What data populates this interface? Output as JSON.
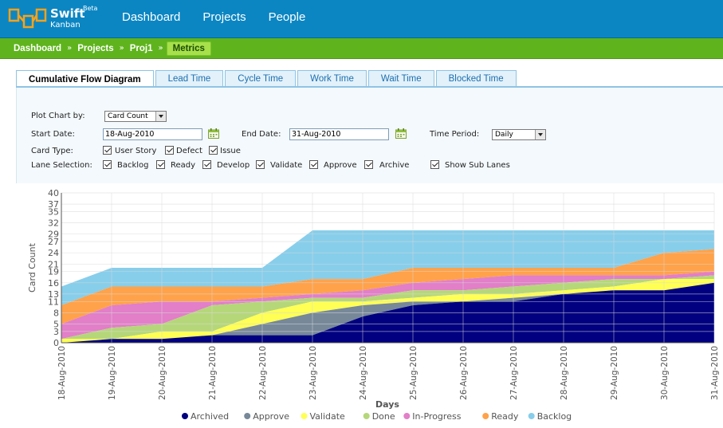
{
  "app": {
    "logo_name": "Swift",
    "logo_beta": "Beta",
    "logo_sub": "Kanban"
  },
  "nav": [
    "Dashboard",
    "Projects",
    "People"
  ],
  "breadcrumb": [
    "Dashboard",
    "Projects",
    "Proj1",
    "Metrics"
  ],
  "breadcrumb_sep": "»",
  "tabs": [
    "Cumulative Flow Diagram",
    "Lead Time",
    "Cycle Time",
    "Work Time",
    "Wait Time",
    "Blocked Time"
  ],
  "form": {
    "plot_by_label": "Plot Chart by:",
    "plot_by_value": "Card Count",
    "start_label": "Start Date:",
    "start_value": "18-Aug-2010",
    "end_label": "End Date:",
    "end_value": "31-Aug-2010",
    "period_label": "Time Period:",
    "period_value": "Daily",
    "card_type_label": "Card Type:",
    "card_types": [
      "User Story",
      "Defect",
      "Issue"
    ],
    "lane_label": "Lane Selection:",
    "lanes": [
      "Backlog",
      "Ready",
      "Develop",
      "Validate",
      "Approve",
      "Archive"
    ],
    "show_sub_lanes": "Show Sub Lanes"
  },
  "colors": {
    "topbar": "#0b86c3",
    "breadcrumb": "#5fb41d"
  },
  "icons": {
    "calendar": "calendar-icon",
    "dropdown": "chevron-down-icon",
    "checkbox": "check-icon"
  },
  "chart_data": {
    "type": "area",
    "stacked": true,
    "ylabel": "Card Count",
    "xlabel": "Days",
    "ylim": [
      0,
      40
    ],
    "yticks": [
      0,
      3,
      5,
      8,
      11,
      13,
      16,
      19,
      21,
      24,
      27,
      29,
      32,
      35,
      37,
      40
    ],
    "grid": true,
    "legend_position": "bottom",
    "categories": [
      "18-Aug-2010",
      "19-Aug-2010",
      "20-Aug-2010",
      "21-Aug-2010",
      "22-Aug-2010",
      "23-Aug-2010",
      "24-Aug-2010",
      "25-Aug-2010",
      "26-Aug-2010",
      "27-Aug-2010",
      "28-Aug-2010",
      "29-Aug-2010",
      "30-Aug-2010",
      "31-Aug-2010"
    ],
    "series": [
      {
        "name": "Archived",
        "color": "#000080",
        "values": [
          0,
          1,
          1,
          2,
          2,
          2,
          7,
          10,
          11,
          11,
          13,
          14,
          14,
          16
        ]
      },
      {
        "name": "Approve",
        "color": "#778899",
        "values": [
          0,
          0,
          0,
          0,
          3,
          6,
          3,
          1,
          0,
          1,
          0,
          0,
          0,
          0
        ]
      },
      {
        "name": "Validate",
        "color": "#ffff55",
        "values": [
          1,
          0,
          2,
          1,
          3,
          3,
          1,
          1,
          2,
          1,
          1,
          1,
          3,
          1
        ]
      },
      {
        "name": "Done",
        "color": "#b5d77a",
        "values": [
          0,
          3,
          2,
          7,
          3,
          1,
          1,
          2,
          1,
          2,
          2,
          2,
          0,
          1
        ]
      },
      {
        "name": "In-Progress",
        "color": "#e27fc8",
        "values": [
          4,
          6,
          6,
          1,
          1,
          1,
          2,
          2,
          3,
          3,
          2,
          1,
          1,
          1
        ]
      },
      {
        "name": "Ready",
        "color": "#ffa24a",
        "values": [
          5,
          5,
          4,
          4,
          3,
          4,
          3,
          4,
          3,
          2,
          2,
          2,
          6,
          6
        ]
      },
      {
        "name": "Backlog",
        "color": "#87ceeb",
        "values": [
          5,
          5,
          5,
          5,
          5,
          13,
          13,
          10,
          10,
          10,
          10,
          10,
          6,
          5
        ]
      }
    ]
  }
}
